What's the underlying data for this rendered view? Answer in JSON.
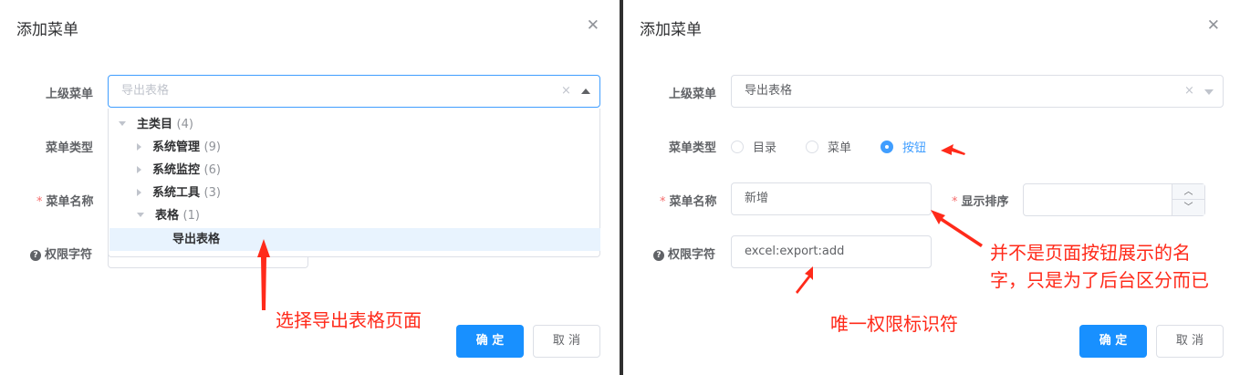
{
  "left_dialog": {
    "title": "添加菜单",
    "close_icon": "close-icon",
    "parent_label": "上级菜单",
    "parent_placeholder": "导出表格",
    "clear_glyph": "×",
    "type_label": "菜单类型",
    "name_label": "菜单名称",
    "perm_label": "权限字符",
    "tree": [
      {
        "label": "主类目",
        "count": "(4)",
        "expanded": true
      },
      {
        "label": "系统管理",
        "count": "(9)"
      },
      {
        "label": "系统监控",
        "count": "(6)"
      },
      {
        "label": "系统工具",
        "count": "(3)"
      },
      {
        "label": "表格",
        "count": "(1)",
        "expanded": true
      },
      {
        "label": "导出表格",
        "count": ""
      }
    ],
    "confirm": "确 定",
    "cancel": "取 消",
    "annotation": "选择导出表格页面"
  },
  "right_dialog": {
    "title": "添加菜单",
    "close_icon": "close-icon",
    "parent_label": "上级菜单",
    "parent_value": "导出表格",
    "clear_glyph": "×",
    "type_label": "菜单类型",
    "type_options": [
      "目录",
      "菜单",
      "按钮"
    ],
    "type_selected": "按钮",
    "name_label": "菜单名称",
    "name_value": "新增",
    "sort_label": "显示排序",
    "sort_value": "",
    "perm_label": "权限字符",
    "perm_value": "excel:export:add",
    "confirm": "确 定",
    "cancel": "取 消",
    "annotation_name_line1": "并不是页面按钮展示的名",
    "annotation_name_line2": "字，只是为了后台区分而已",
    "annotation_perm": "唯一权限标识符"
  },
  "colors": {
    "primary": "#1890ff",
    "annotation_red": "#ff2a1a",
    "required": "#f56c6c",
    "selected_bg": "#e8f3fe"
  }
}
